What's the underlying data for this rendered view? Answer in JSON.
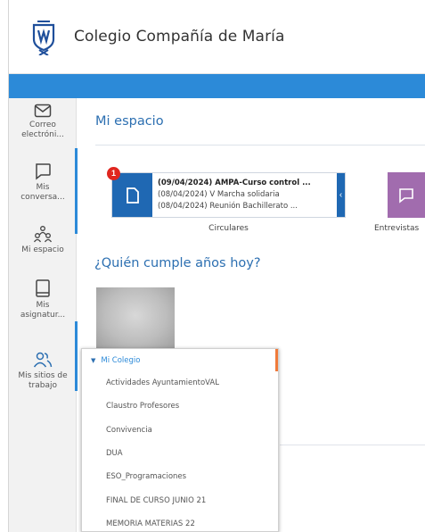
{
  "app": {
    "title": "Colegio Compañía de María"
  },
  "sidebar": {
    "items": [
      {
        "icon": "mail-icon",
        "label": "Correo electróni..."
      },
      {
        "icon": "chat-icon",
        "label": "Mis conversa..."
      },
      {
        "icon": "people-group-icon",
        "label": "Mi espacio"
      },
      {
        "icon": "book-icon",
        "label": "Mis asignatur..."
      },
      {
        "icon": "users-icon",
        "label": "Mis sitios de trabajo"
      }
    ]
  },
  "main": {
    "section_title": "Mi espacio",
    "circulares": {
      "badge": "1",
      "lines": [
        "(09/04/2024) AMPA-Curso control ...",
        "(08/04/2024) V Marcha solidaria",
        "(08/04/2024) Reunión Bachillerato ..."
      ],
      "caption": "Circulares"
    },
    "entrevistas": {
      "caption": "Entrevistas"
    },
    "birthday_title": "¿Quién cumple años hoy?"
  },
  "dropdown": {
    "header": "Mi Colegio",
    "items": [
      "Actividades AyuntamientoVAL",
      "Claustro Profesores",
      "Convivencia",
      "DUA",
      "ESO_Programaciones",
      "FINAL DE CURSO JUNIO 21",
      "MEMORIA MATERIAS 22"
    ]
  },
  "colors": {
    "accent": "#2c8ad8",
    "widget_blue": "#1f68b3",
    "widget_purple": "#a16cae",
    "badge": "#e0261f",
    "dropdown_marker": "#f07a3a"
  }
}
